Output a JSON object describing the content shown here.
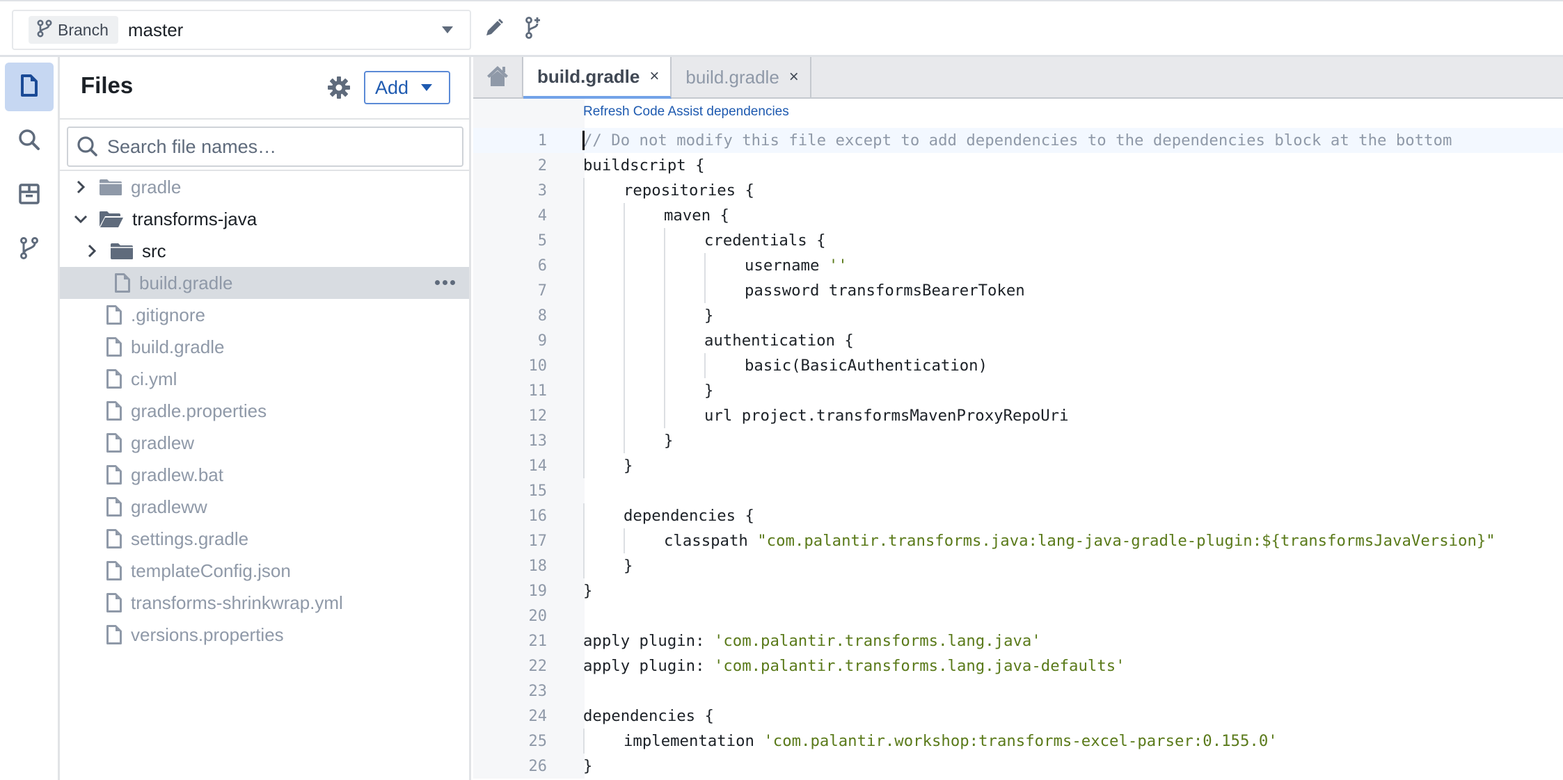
{
  "topbar": {
    "branch_label": "Branch",
    "branch_value": "master",
    "icons": [
      "git-branch-icon",
      "edit-pencil-icon",
      "new-branch-icon"
    ]
  },
  "activity_bar": {
    "items": [
      {
        "name": "files",
        "icon": "file-icon",
        "active": true
      },
      {
        "name": "search",
        "icon": "search-icon",
        "active": false
      },
      {
        "name": "libraries",
        "icon": "package-box-icon",
        "active": false
      },
      {
        "name": "branches",
        "icon": "git-branch-icon",
        "active": false
      }
    ]
  },
  "files_panel": {
    "title": "Files",
    "add_label": "Add",
    "search_placeholder": "Search file names…",
    "tree": [
      {
        "name": "gradle",
        "type": "folder",
        "expanded": false,
        "depth": 0,
        "muted": true
      },
      {
        "name": "transforms-java",
        "type": "folder",
        "expanded": true,
        "depth": 0,
        "muted": false
      },
      {
        "name": "src",
        "type": "folder",
        "expanded": false,
        "depth": 1,
        "muted": false
      },
      {
        "name": "build.gradle",
        "type": "file",
        "depth": 1,
        "selected": true
      },
      {
        "name": ".gitignore",
        "type": "file",
        "depth": 0
      },
      {
        "name": "build.gradle",
        "type": "file",
        "depth": 0
      },
      {
        "name": "ci.yml",
        "type": "file",
        "depth": 0
      },
      {
        "name": "gradle.properties",
        "type": "file",
        "depth": 0
      },
      {
        "name": "gradlew",
        "type": "file",
        "depth": 0
      },
      {
        "name": "gradlew.bat",
        "type": "file",
        "depth": 0
      },
      {
        "name": "gradleww",
        "type": "file",
        "depth": 0
      },
      {
        "name": "settings.gradle",
        "type": "file",
        "depth": 0
      },
      {
        "name": "templateConfig.json",
        "type": "file",
        "depth": 0
      },
      {
        "name": "transforms-shrinkwrap.yml",
        "type": "file",
        "depth": 0
      },
      {
        "name": "versions.properties",
        "type": "file",
        "depth": 0
      }
    ]
  },
  "editor": {
    "tabs": [
      {
        "label": "build.gradle",
        "active": true,
        "close": "×"
      },
      {
        "label": "build.gradle",
        "active": false,
        "close": "×"
      }
    ],
    "codelens": "Refresh Code Assist dependencies",
    "lines": [
      {
        "n": "1",
        "indent": 0,
        "parts": [
          [
            "cmt",
            "// Do not modify this file except to add dependencies to the dependencies block at the bottom"
          ]
        ]
      },
      {
        "n": "2",
        "indent": 0,
        "parts": [
          [
            "",
            "buildscript {"
          ]
        ]
      },
      {
        "n": "3",
        "indent": 1,
        "parts": [
          [
            "",
            "repositories {"
          ]
        ]
      },
      {
        "n": "4",
        "indent": 2,
        "parts": [
          [
            "",
            "maven {"
          ]
        ]
      },
      {
        "n": "5",
        "indent": 3,
        "parts": [
          [
            "",
            "credentials {"
          ]
        ]
      },
      {
        "n": "6",
        "indent": 4,
        "parts": [
          [
            "",
            "username "
          ],
          [
            "str",
            "''"
          ]
        ]
      },
      {
        "n": "7",
        "indent": 4,
        "parts": [
          [
            "",
            "password transformsBearerToken"
          ]
        ]
      },
      {
        "n": "8",
        "indent": 3,
        "parts": [
          [
            "",
            "}"
          ]
        ]
      },
      {
        "n": "9",
        "indent": 3,
        "parts": [
          [
            "",
            "authentication {"
          ]
        ]
      },
      {
        "n": "10",
        "indent": 4,
        "parts": [
          [
            "",
            "basic(BasicAuthentication)"
          ]
        ]
      },
      {
        "n": "11",
        "indent": 3,
        "parts": [
          [
            "",
            "}"
          ]
        ]
      },
      {
        "n": "12",
        "indent": 3,
        "parts": [
          [
            "",
            "url project.transformsMavenProxyRepoUri"
          ]
        ]
      },
      {
        "n": "13",
        "indent": 2,
        "parts": [
          [
            "",
            "}"
          ]
        ]
      },
      {
        "n": "14",
        "indent": 1,
        "parts": [
          [
            "",
            "}"
          ]
        ]
      },
      {
        "n": "15",
        "indent": 0,
        "parts": []
      },
      {
        "n": "16",
        "indent": 1,
        "parts": [
          [
            "",
            "dependencies {"
          ]
        ]
      },
      {
        "n": "17",
        "indent": 2,
        "parts": [
          [
            "",
            "classpath "
          ],
          [
            "str",
            "\"com.palantir.transforms.java:lang-java-gradle-plugin:${transformsJavaVersion}\""
          ]
        ]
      },
      {
        "n": "18",
        "indent": 1,
        "parts": [
          [
            "",
            "}"
          ]
        ]
      },
      {
        "n": "19",
        "indent": 0,
        "parts": [
          [
            "",
            "}"
          ]
        ]
      },
      {
        "n": "20",
        "indent": 0,
        "parts": []
      },
      {
        "n": "21",
        "indent": 0,
        "parts": [
          [
            "",
            "apply plugin: "
          ],
          [
            "str",
            "'com.palantir.transforms.lang.java'"
          ]
        ]
      },
      {
        "n": "22",
        "indent": 0,
        "parts": [
          [
            "",
            "apply plugin: "
          ],
          [
            "str",
            "'com.palantir.transforms.lang.java-defaults'"
          ]
        ]
      },
      {
        "n": "23",
        "indent": 0,
        "parts": []
      },
      {
        "n": "24",
        "indent": 0,
        "parts": [
          [
            "",
            "dependencies {"
          ]
        ]
      },
      {
        "n": "25",
        "indent": 1,
        "parts": [
          [
            "",
            "implementation "
          ],
          [
            "str",
            "'com.palantir.workshop:transforms-excel-parser:0.155.0'"
          ]
        ]
      },
      {
        "n": "26",
        "indent": 0,
        "parts": [
          [
            "",
            "}"
          ]
        ]
      }
    ]
  },
  "colors": {
    "accent": "#1e5ab0",
    "active_activity_bg": "#c6d7f2",
    "string": "#5a7a1a",
    "comment": "#8f99a8",
    "selected_row": "#d8dce1"
  }
}
